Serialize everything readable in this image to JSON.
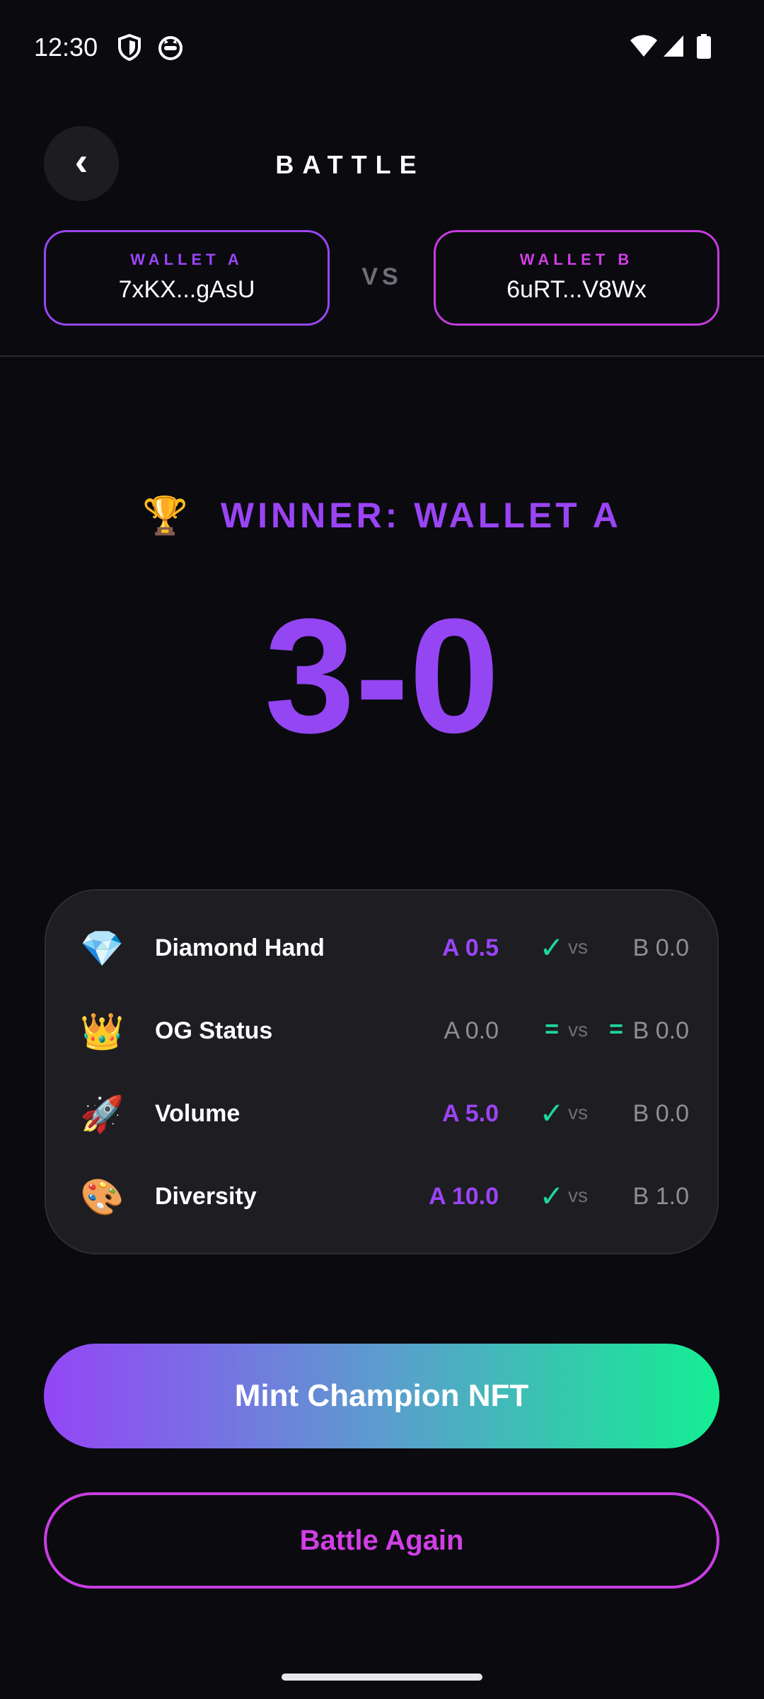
{
  "status_bar": {
    "time": "12:30",
    "icons": [
      "shield-icon",
      "cat-face-icon",
      "wifi-icon",
      "cellular-signal-icon",
      "battery-icon"
    ]
  },
  "header": {
    "back_icon": "chevron-left-icon",
    "back_glyph": "‹",
    "title": "BATTLE"
  },
  "wallets": {
    "a": {
      "label": "WALLET A",
      "address": "7xKX...gAsU"
    },
    "vs": "VS",
    "b": {
      "label": "WALLET B",
      "address": "6uRT...V8Wx"
    }
  },
  "result": {
    "trophy": "🏆",
    "winner_text": "WINNER: WALLET A",
    "score": "3-0"
  },
  "stats": [
    {
      "icon": "💎",
      "icon_name": "gem-icon",
      "label": "Diamond Hand",
      "a": "A 0.5",
      "mark": "✓",
      "vs": "vs",
      "b": "B 0.0"
    },
    {
      "icon": "👑",
      "icon_name": "crown-icon",
      "label": "OG Status",
      "a": "A 0.0",
      "mark": "=",
      "vs": "vs",
      "mark2": "=",
      "b": "B 0.0"
    },
    {
      "icon": "🚀",
      "icon_name": "rocket-icon",
      "label": "Volume",
      "a": "A 5.0",
      "mark": "✓",
      "vs": "vs",
      "b": "B 0.0"
    },
    {
      "icon": "🎨",
      "icon_name": "palette-icon",
      "label": "Diversity",
      "a": "A 10.0",
      "mark": "✓",
      "vs": "vs",
      "b": "B 1.0"
    }
  ],
  "actions": {
    "mint_label": "Mint Champion NFT",
    "again_label": "Battle Again"
  },
  "colors": {
    "background": "#0a0a0f",
    "purple": "#9b44f5",
    "magenta": "#d13fe4",
    "green": "#1ed79a",
    "card": "#1d1d22"
  }
}
